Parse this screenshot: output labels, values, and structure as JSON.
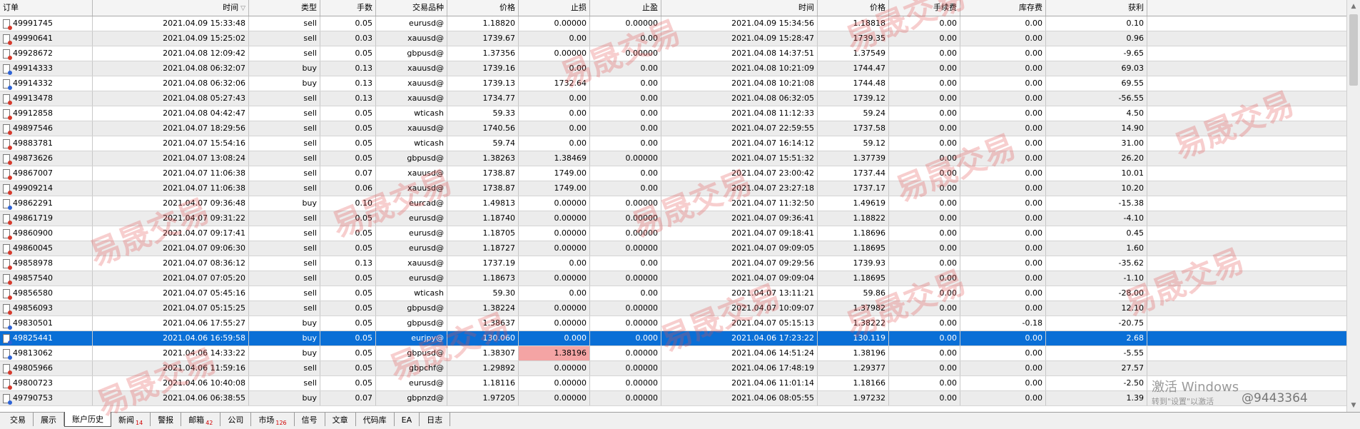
{
  "headers": [
    "订单",
    "时间",
    "类型",
    "手数",
    "交易品种",
    "价格",
    "止损",
    "止盈",
    "时间",
    "价格",
    "手续费",
    "库存费",
    "获利"
  ],
  "rows": [
    {
      "order": "49991745",
      "open_time": "2021.04.09 15:33:48",
      "type": "sell",
      "lots": "0.05",
      "symbol": "eurusd@",
      "open_price": "1.18820",
      "sl": "0.00000",
      "tp": "0.00000",
      "close_time": "2021.04.09 15:34:56",
      "close_price": "1.18818",
      "commission": "0.00",
      "swap": "0.00",
      "profit": "0.10"
    },
    {
      "order": "49990641",
      "open_time": "2021.04.09 15:25:02",
      "type": "sell",
      "lots": "0.03",
      "symbol": "xauusd@",
      "open_price": "1739.67",
      "sl": "0.00",
      "tp": "0.00",
      "close_time": "2021.04.09 15:28:47",
      "close_price": "1739.35",
      "commission": "0.00",
      "swap": "0.00",
      "profit": "0.96"
    },
    {
      "order": "49928672",
      "open_time": "2021.04.08 12:09:42",
      "type": "sell",
      "lots": "0.05",
      "symbol": "gbpusd@",
      "open_price": "1.37356",
      "sl": "0.00000",
      "tp": "0.00000",
      "close_time": "2021.04.08 14:37:51",
      "close_price": "1.37549",
      "commission": "0.00",
      "swap": "0.00",
      "profit": "-9.65"
    },
    {
      "order": "49914333",
      "open_time": "2021.04.08 06:32:07",
      "type": "buy",
      "lots": "0.13",
      "symbol": "xauusd@",
      "open_price": "1739.16",
      "sl": "0.00",
      "tp": "0.00",
      "close_time": "2021.04.08 10:21:09",
      "close_price": "1744.47",
      "commission": "0.00",
      "swap": "0.00",
      "profit": "69.03"
    },
    {
      "order": "49914332",
      "open_time": "2021.04.08 06:32:06",
      "type": "buy",
      "lots": "0.13",
      "symbol": "xauusd@",
      "open_price": "1739.13",
      "sl": "1732.64",
      "tp": "0.00",
      "close_time": "2021.04.08 10:21:08",
      "close_price": "1744.48",
      "commission": "0.00",
      "swap": "0.00",
      "profit": "69.55"
    },
    {
      "order": "49913478",
      "open_time": "2021.04.08 05:27:43",
      "type": "sell",
      "lots": "0.13",
      "symbol": "xauusd@",
      "open_price": "1734.77",
      "sl": "0.00",
      "tp": "0.00",
      "close_time": "2021.04.08 06:32:05",
      "close_price": "1739.12",
      "commission": "0.00",
      "swap": "0.00",
      "profit": "-56.55"
    },
    {
      "order": "49912858",
      "open_time": "2021.04.08 04:42:47",
      "type": "sell",
      "lots": "0.05",
      "symbol": "wticash",
      "open_price": "59.33",
      "sl": "0.00",
      "tp": "0.00",
      "close_time": "2021.04.08 11:12:33",
      "close_price": "59.24",
      "commission": "0.00",
      "swap": "0.00",
      "profit": "4.50"
    },
    {
      "order": "49897546",
      "open_time": "2021.04.07 18:29:56",
      "type": "sell",
      "lots": "0.05",
      "symbol": "xauusd@",
      "open_price": "1740.56",
      "sl": "0.00",
      "tp": "0.00",
      "close_time": "2021.04.07 22:59:55",
      "close_price": "1737.58",
      "commission": "0.00",
      "swap": "0.00",
      "profit": "14.90"
    },
    {
      "order": "49883781",
      "open_time": "2021.04.07 15:54:16",
      "type": "sell",
      "lots": "0.05",
      "symbol": "wticash",
      "open_price": "59.74",
      "sl": "0.00",
      "tp": "0.00",
      "close_time": "2021.04.07 16:14:12",
      "close_price": "59.12",
      "commission": "0.00",
      "swap": "0.00",
      "profit": "31.00"
    },
    {
      "order": "49873626",
      "open_time": "2021.04.07 13:08:24",
      "type": "sell",
      "lots": "0.05",
      "symbol": "gbpusd@",
      "open_price": "1.38263",
      "sl": "1.38469",
      "tp": "0.00000",
      "close_time": "2021.04.07 15:51:32",
      "close_price": "1.37739",
      "commission": "0.00",
      "swap": "0.00",
      "profit": "26.20"
    },
    {
      "order": "49867007",
      "open_time": "2021.04.07 11:06:38",
      "type": "sell",
      "lots": "0.07",
      "symbol": "xauusd@",
      "open_price": "1738.87",
      "sl": "1749.00",
      "tp": "0.00",
      "close_time": "2021.04.07 23:00:42",
      "close_price": "1737.44",
      "commission": "0.00",
      "swap": "0.00",
      "profit": "10.01"
    },
    {
      "order": "49909214",
      "open_time": "2021.04.07 11:06:38",
      "type": "sell",
      "lots": "0.06",
      "symbol": "xauusd@",
      "open_price": "1738.87",
      "sl": "1749.00",
      "tp": "0.00",
      "close_time": "2021.04.07 23:27:18",
      "close_price": "1737.17",
      "commission": "0.00",
      "swap": "0.00",
      "profit": "10.20"
    },
    {
      "order": "49862291",
      "open_time": "2021.04.07 09:36:48",
      "type": "buy",
      "lots": "0.10",
      "symbol": "eurcad@",
      "open_price": "1.49813",
      "sl": "0.00000",
      "tp": "0.00000",
      "close_time": "2021.04.07 11:32:50",
      "close_price": "1.49619",
      "commission": "0.00",
      "swap": "0.00",
      "profit": "-15.38"
    },
    {
      "order": "49861719",
      "open_time": "2021.04.07 09:31:22",
      "type": "sell",
      "lots": "0.05",
      "symbol": "eurusd@",
      "open_price": "1.18740",
      "sl": "0.00000",
      "tp": "0.00000",
      "close_time": "2021.04.07 09:36:41",
      "close_price": "1.18822",
      "commission": "0.00",
      "swap": "0.00",
      "profit": "-4.10"
    },
    {
      "order": "49860900",
      "open_time": "2021.04.07 09:17:41",
      "type": "sell",
      "lots": "0.05",
      "symbol": "eurusd@",
      "open_price": "1.18705",
      "sl": "0.00000",
      "tp": "0.00000",
      "close_time": "2021.04.07 09:18:41",
      "close_price": "1.18696",
      "commission": "0.00",
      "swap": "0.00",
      "profit": "0.45"
    },
    {
      "order": "49860045",
      "open_time": "2021.04.07 09:06:30",
      "type": "sell",
      "lots": "0.05",
      "symbol": "eurusd@",
      "open_price": "1.18727",
      "sl": "0.00000",
      "tp": "0.00000",
      "close_time": "2021.04.07 09:09:05",
      "close_price": "1.18695",
      "commission": "0.00",
      "swap": "0.00",
      "profit": "1.60"
    },
    {
      "order": "49858978",
      "open_time": "2021.04.07 08:36:12",
      "type": "sell",
      "lots": "0.13",
      "symbol": "xauusd@",
      "open_price": "1737.19",
      "sl": "0.00",
      "tp": "0.00",
      "close_time": "2021.04.07 09:29:56",
      "close_price": "1739.93",
      "commission": "0.00",
      "swap": "0.00",
      "profit": "-35.62"
    },
    {
      "order": "49857540",
      "open_time": "2021.04.07 07:05:20",
      "type": "sell",
      "lots": "0.05",
      "symbol": "eurusd@",
      "open_price": "1.18673",
      "sl": "0.00000",
      "tp": "0.00000",
      "close_time": "2021.04.07 09:09:04",
      "close_price": "1.18695",
      "commission": "0.00",
      "swap": "0.00",
      "profit": "-1.10"
    },
    {
      "order": "49856580",
      "open_time": "2021.04.07 05:45:16",
      "type": "sell",
      "lots": "0.05",
      "symbol": "wticash",
      "open_price": "59.30",
      "sl": "0.00",
      "tp": "0.00",
      "close_time": "2021.04.07 13:11:21",
      "close_price": "59.86",
      "commission": "0.00",
      "swap": "0.00",
      "profit": "-28.00"
    },
    {
      "order": "49856093",
      "open_time": "2021.04.07 05:15:25",
      "type": "sell",
      "lots": "0.05",
      "symbol": "gbpusd@",
      "open_price": "1.38224",
      "sl": "0.00000",
      "tp": "0.00000",
      "close_time": "2021.04.07 10:09:07",
      "close_price": "1.37982",
      "commission": "0.00",
      "swap": "0.00",
      "profit": "12.10"
    },
    {
      "order": "49830501",
      "open_time": "2021.04.06 17:55:27",
      "type": "buy",
      "lots": "0.05",
      "symbol": "gbpusd@",
      "open_price": "1.38637",
      "sl": "0.00000",
      "tp": "0.00000",
      "close_time": "2021.04.07 05:15:13",
      "close_price": "1.38222",
      "commission": "0.00",
      "swap": "-0.18",
      "profit": "-20.75"
    },
    {
      "order": "49825441",
      "open_time": "2021.04.06 16:59:58",
      "type": "buy",
      "lots": "0.05",
      "symbol": "eurjpy@",
      "open_price": "130.060",
      "sl": "0.000",
      "tp": "0.000",
      "close_time": "2021.04.06 17:23:22",
      "close_price": "130.119",
      "commission": "0.00",
      "swap": "0.00",
      "profit": "2.68"
    },
    {
      "order": "49813062",
      "open_time": "2021.04.06 14:33:22",
      "type": "buy",
      "lots": "0.05",
      "symbol": "gbpusd@",
      "open_price": "1.38307",
      "sl": "1.38196",
      "tp": "0.00000",
      "close_time": "2021.04.06 14:51:24",
      "close_price": "1.38196",
      "commission": "0.00",
      "swap": "0.00",
      "profit": "-5.55"
    },
    {
      "order": "49805966",
      "open_time": "2021.04.06 11:59:16",
      "type": "sell",
      "lots": "0.05",
      "symbol": "gbpchf@",
      "open_price": "1.29892",
      "sl": "0.00000",
      "tp": "0.00000",
      "close_time": "2021.04.06 17:48:19",
      "close_price": "1.29377",
      "commission": "0.00",
      "swap": "0.00",
      "profit": "27.57"
    },
    {
      "order": "49800723",
      "open_time": "2021.04.06 10:40:08",
      "type": "sell",
      "lots": "0.05",
      "symbol": "eurusd@",
      "open_price": "1.18116",
      "sl": "0.00000",
      "tp": "0.00000",
      "close_time": "2021.04.06 11:01:14",
      "close_price": "1.18166",
      "commission": "0.00",
      "swap": "0.00",
      "profit": "-2.50"
    },
    {
      "order": "49790753",
      "open_time": "2021.04.06 06:38:55",
      "type": "buy",
      "lots": "0.07",
      "symbol": "gbpnzd@",
      "open_price": "1.97205",
      "sl": "0.00000",
      "tp": "0.00000",
      "close_time": "2021.04.06 08:05:55",
      "close_price": "1.97232",
      "commission": "0.00",
      "swap": "0.00",
      "profit": "1.39"
    }
  ],
  "selected_order": "49825441",
  "highlighted_stoploss_orders": [
    "49813062"
  ],
  "tabs": [
    {
      "label": "交易"
    },
    {
      "label": "展示"
    },
    {
      "label": "账户历史",
      "active": true
    },
    {
      "label": "新闻",
      "badge": "14"
    },
    {
      "label": "警报"
    },
    {
      "label": "邮箱",
      "badge": "42"
    },
    {
      "label": "公司"
    },
    {
      "label": "市场",
      "badge": "126"
    },
    {
      "label": "信号"
    },
    {
      "label": "文章"
    },
    {
      "label": "代码库"
    },
    {
      "label": "EA"
    },
    {
      "label": "日志"
    }
  ],
  "watermark_text": "易晟交易",
  "activation_notice": {
    "line1": "激活 Windows",
    "line2": "转到\"设置\"以激活"
  },
  "overlay_id": "@9443364",
  "colors": {
    "selection": "#0a6fd6",
    "stoploss_highlight": "#f4a4a4",
    "alt_row": "#ececec",
    "watermark": "#e15050"
  },
  "icons": {
    "buy": "doc-buy-icon",
    "sell": "doc-sell-icon"
  }
}
